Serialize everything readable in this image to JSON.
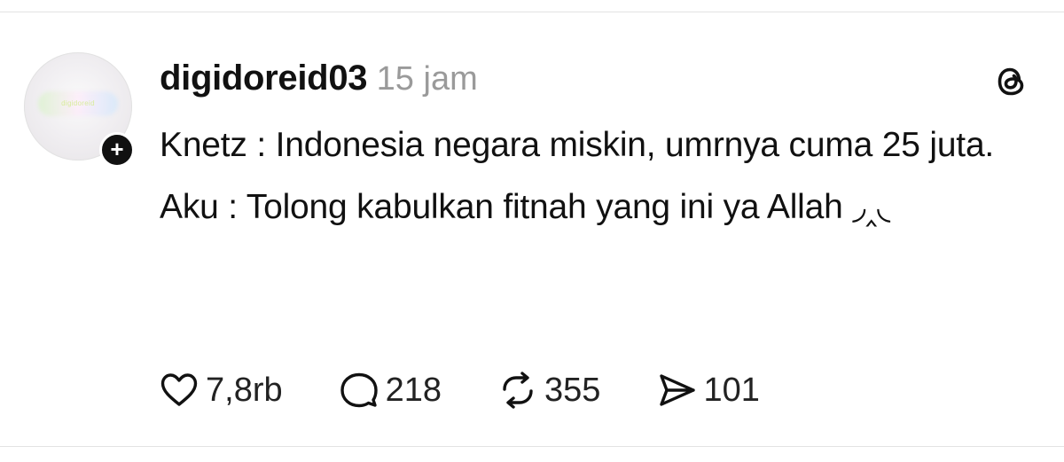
{
  "post": {
    "username": "digidoreid03",
    "timestamp": "15 jam",
    "avatar_text": "digidoreid",
    "follow_symbol": "+",
    "paragraphs": [
      "Knetz : Indonesia negara miskin, umrnya cuma 25 juta.",
      "Aku : Tolong kabulkan fitnah yang ini ya Allah ◞‸◟"
    ]
  },
  "actions": {
    "like": {
      "icon": "heart-icon",
      "count": "7,8rb"
    },
    "comment": {
      "icon": "comment-icon",
      "count": "218"
    },
    "repost": {
      "icon": "repost-icon",
      "count": "355"
    },
    "share": {
      "icon": "share-icon",
      "count": "101"
    }
  },
  "app_icon": "threads-logo-icon",
  "colors": {
    "text": "#111111",
    "muted": "#9a9a9a",
    "divider": "#e3e3e3"
  }
}
